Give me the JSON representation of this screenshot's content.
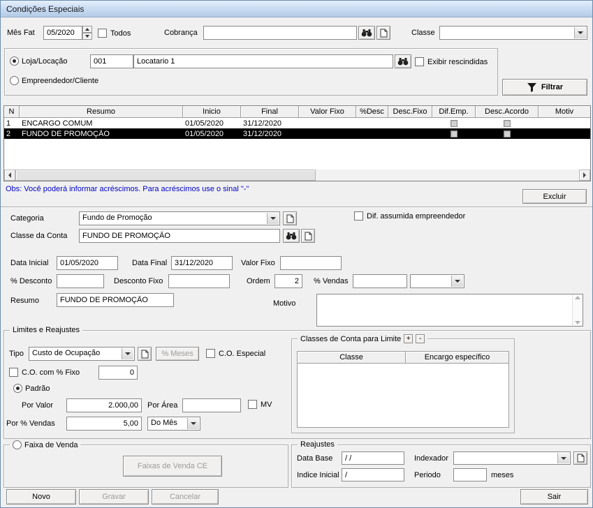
{
  "window": {
    "title": "Condições Especiais"
  },
  "topbar": {
    "mes_fat": {
      "label": "Mês Fat",
      "value": "05/2020"
    },
    "todos": {
      "label": "Todos"
    },
    "cobranca": {
      "label": "Cobrança",
      "value": ""
    },
    "classe": {
      "label": "Classe",
      "value": ""
    }
  },
  "selector": {
    "loja": {
      "label": "Loja/Locação",
      "code": "001",
      "name": "Locatario 1"
    },
    "exibir_rescindidas": {
      "label": "Exibir rescindidas"
    },
    "empreendedor": {
      "label": "Empreendedor/Cliente"
    },
    "filtrar": {
      "label": "Filtrar"
    }
  },
  "grid": {
    "columns": [
      "N",
      "Resumo",
      "Inicio",
      "Final",
      "Valor Fixo",
      "%Desc",
      "Desc.Fixo",
      "Dif.Emp.",
      "Desc.Acordo",
      "Motiv"
    ],
    "rows": [
      {
        "n": "1",
        "resumo": "ENCARGO COMUM",
        "inicio": "01/05/2020",
        "final": "31/12/2020"
      },
      {
        "n": "2",
        "resumo": "FUNDO DE PROMOÇÃO",
        "inicio": "01/05/2020",
        "final": "31/12/2020"
      }
    ]
  },
  "obs": {
    "text": "Obs: Você poderá informar acréscimos. Para acréscimos use o sinal \"-\""
  },
  "actions": {
    "excluir": "Excluir",
    "novo": "Novo",
    "gravar": "Gravar",
    "cancelar": "Cancelar",
    "sair": "Sair"
  },
  "form": {
    "categoria": {
      "label": "Categoria",
      "value": "Fundo de Promoção"
    },
    "dif_assumida": {
      "label": "Dif. assumida empreendedor"
    },
    "classe_conta": {
      "label": "Classe da Conta",
      "value": "FUNDO DE PROMOÇÃO"
    },
    "data_inicial": {
      "label": "Data Inicial",
      "value": "01/05/2020"
    },
    "data_final": {
      "label": "Data Final",
      "value": "31/12/2020"
    },
    "valor_fixo": {
      "label": "Valor Fixo",
      "value": ""
    },
    "pct_desconto": {
      "label": "% Desconto",
      "value": ""
    },
    "desconto_fixo": {
      "label": "Desconto Fixo",
      "value": ""
    },
    "ordem": {
      "label": "Ordem",
      "value": "2"
    },
    "pct_vendas": {
      "label": "% Vendas",
      "value": "",
      "unit_value": ""
    },
    "resumo": {
      "label": "Resumo",
      "value": "FUNDO DE PROMOÇÃO"
    },
    "motivo": {
      "label": "Motivo",
      "value": ""
    }
  },
  "limites": {
    "title": "Limites e Reajustes",
    "tipo": {
      "label": "Tipo",
      "value": "Custo de Ocupação"
    },
    "pct_meses": {
      "label": "% Meses"
    },
    "co_especial": {
      "label": "C.O. Especial"
    },
    "co_fixo": {
      "label": "C.O. com % Fixo",
      "value": "0"
    },
    "padrao": {
      "label": "Padrão"
    },
    "por_valor": {
      "label": "Por Valor",
      "value": "2.000,00"
    },
    "por_area": {
      "label": "Por Área",
      "value": ""
    },
    "mv": {
      "label": "MV"
    },
    "por_pct_vendas": {
      "label": "Por % Vendas",
      "value": "5,00"
    },
    "periodo_combo": {
      "value": "Do Mês"
    }
  },
  "classes_limite": {
    "title": "Classes de Conta para Limite",
    "add": "+",
    "remove": "-",
    "columns": [
      "Classe",
      "Encargo específico"
    ]
  },
  "faixa_venda": {
    "title": "Faixa de Venda",
    "button": "Faixas de Venda CE"
  },
  "reajustes": {
    "title": "Reajustes",
    "data_base": {
      "label": "Data Base",
      "value": "/ /"
    },
    "indexador": {
      "label": "Indexador",
      "value": ""
    },
    "indice_inicial": {
      "label": "Indice Inicial",
      "value": "/"
    },
    "periodo": {
      "label": "Periodo",
      "value": ""
    },
    "meses_label": "meses"
  }
}
